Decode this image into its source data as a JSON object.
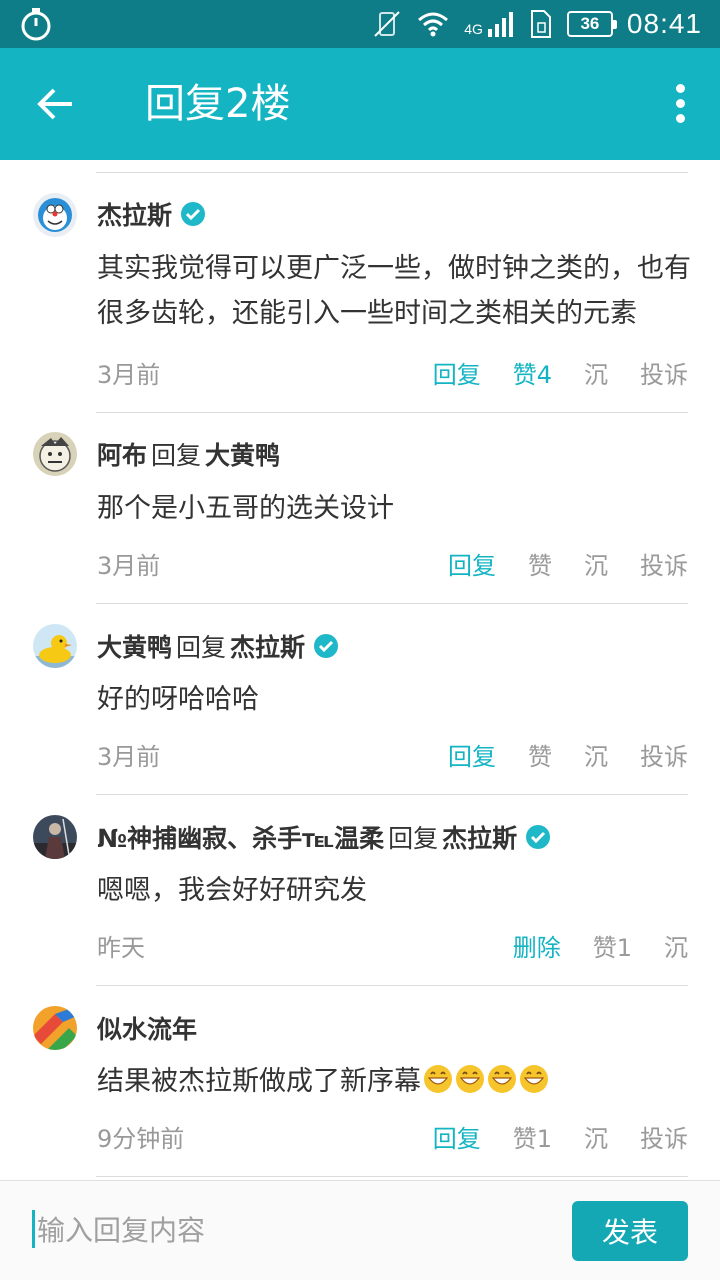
{
  "status_bar": {
    "time": "08:41",
    "battery": "36",
    "network": "4G"
  },
  "app_bar": {
    "title": "回复2楼"
  },
  "comments": [
    {
      "name": "杰拉斯",
      "reply_word": "",
      "target": "",
      "name_verified": true,
      "target_verified": false,
      "text": "其实我觉得可以更广泛一些，做时钟之类的，也有很多齿轮，还能引入一些时间之类相关的元素",
      "time": "3月前",
      "actions": [
        "回复",
        "赞4",
        "沉",
        "投诉"
      ]
    },
    {
      "name": "阿布",
      "reply_word": "回复",
      "target": "大黄鸭",
      "name_verified": false,
      "target_verified": false,
      "text": "那个是小五哥的选关设计",
      "time": "3月前",
      "actions": [
        "回复",
        "赞",
        "沉",
        "投诉"
      ]
    },
    {
      "name": "大黄鸭",
      "reply_word": "回复",
      "target": "杰拉斯",
      "name_verified": false,
      "target_verified": true,
      "text": "好的呀哈哈哈",
      "time": "3月前",
      "actions": [
        "回复",
        "赞",
        "沉",
        "投诉"
      ]
    },
    {
      "name": "№神捕幽寂、杀手℡温柔",
      "reply_word": "回复",
      "target": "杰拉斯",
      "name_verified": false,
      "target_verified": true,
      "text": "嗯嗯，我会好好研究发",
      "time": "昨天",
      "actions": [
        "删除",
        "赞1",
        "沉"
      ]
    },
    {
      "name": "似水流年",
      "reply_word": "",
      "target": "",
      "name_verified": false,
      "target_verified": false,
      "text": "结果被杰拉斯做成了新序幕",
      "emoji": "grinning-face-emoji",
      "emoji_count": 4,
      "time": "9分钟前",
      "actions": [
        "回复",
        "赞1",
        "沉",
        "投诉"
      ]
    }
  ],
  "input_bar": {
    "placeholder": "输入回复内容",
    "send_label": "发表"
  },
  "colors": {
    "status_bar": "#0f7d87",
    "app_bar": "#14b4c3",
    "accent": "#14b4c3",
    "send_button": "#14a8b4",
    "verified": "#1fb8c8"
  },
  "icons": {
    "stopwatch": "stopwatch-icon",
    "back": "back-arrow-icon",
    "more": "more-vertical-icon",
    "verified": "verified-badge-icon",
    "wifi": "wifi-icon",
    "signal": "signal-icon",
    "mute": "vibrate-off-icon",
    "sim": "sim-icon"
  }
}
